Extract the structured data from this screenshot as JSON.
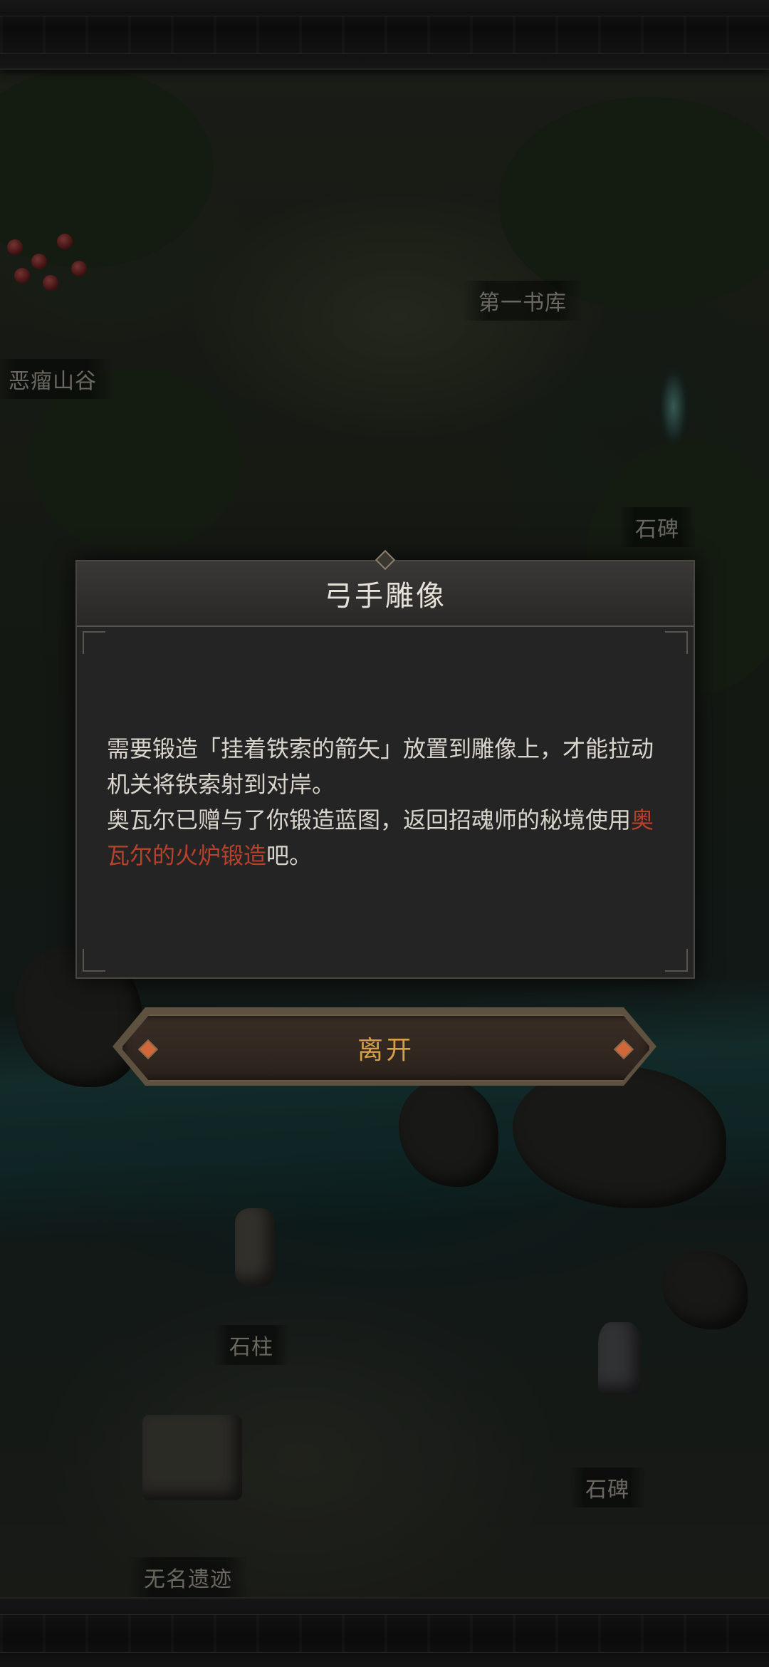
{
  "map": {
    "locations": [
      {
        "id": "valley",
        "label": "恶瘤山谷"
      },
      {
        "id": "library",
        "label": "第一书库"
      },
      {
        "id": "stele-1",
        "label": "石碑"
      },
      {
        "id": "pillar",
        "label": "石柱"
      },
      {
        "id": "stele-2",
        "label": "石碑"
      },
      {
        "id": "ruins",
        "label": "无名遗迹"
      }
    ]
  },
  "dialog": {
    "title": "弓手雕像",
    "line1": "需要锻造「挂着铁索的箭矢」放置到雕像上，才能拉动机关将铁索射到对岸。",
    "line2_before": "奥瓦尔已赠与了你锻造蓝图，返回招魂师的秘境使用",
    "line2_highlight": "奥瓦尔的火炉锻造",
    "line2_after": "吧。",
    "highlight_color": "#b8412c"
  },
  "buttons": {
    "leave": "离开"
  }
}
